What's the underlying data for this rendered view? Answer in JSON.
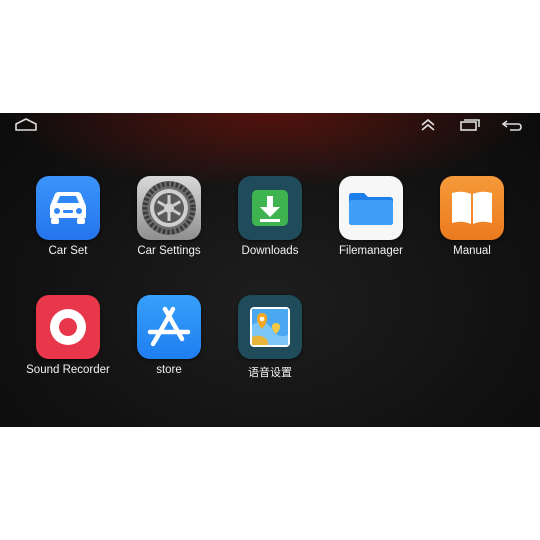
{
  "statusbar": {
    "icons": [
      "home-icon",
      "expand-up-icon",
      "recent-apps-icon",
      "back-icon"
    ]
  },
  "apps": [
    {
      "label": "Car Set",
      "icon": "car-icon"
    },
    {
      "label": "Car Settings",
      "icon": "gear-icon"
    },
    {
      "label": "Downloads",
      "icon": "download-icon"
    },
    {
      "label": "Filemanager",
      "icon": "folder-icon"
    },
    {
      "label": "Manual",
      "icon": "book-icon"
    },
    {
      "label": "Sound Recorder",
      "icon": "record-icon"
    },
    {
      "label": "store",
      "icon": "app-store-icon"
    },
    {
      "label": "语音设置",
      "icon": "voice-map-icon"
    }
  ],
  "colors": {
    "car_set": "#2f86f6",
    "downloads_bg": "#1f4b5a",
    "downloads_fg": "#3fb34f",
    "filemanager_bg": "#f7f7f7",
    "folder": "#2b8ff2",
    "manual": "#f18a2b",
    "recorder": "#e8364a",
    "store": "#2a8ff5"
  }
}
